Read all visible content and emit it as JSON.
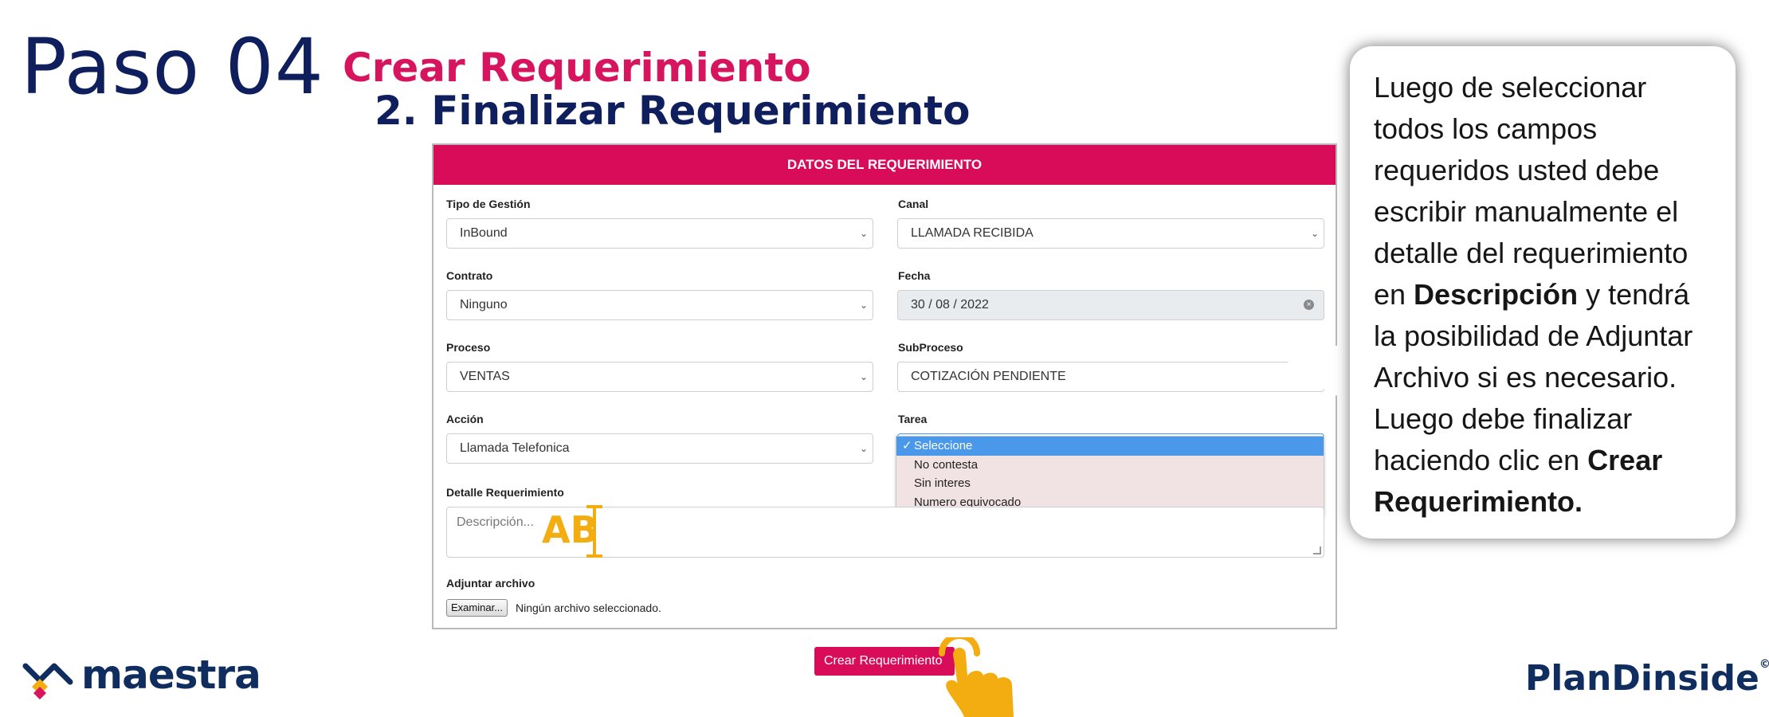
{
  "step": {
    "label": "Paso 04"
  },
  "titles": {
    "main": "Crear Requerimiento",
    "sub": "2. Finalizar Requerimiento"
  },
  "form": {
    "header": "DATOS DEL REQUERIMIENTO",
    "tipo_gestion": {
      "label": "Tipo de Gestión",
      "value": "InBound"
    },
    "canal": {
      "label": "Canal",
      "value": "LLAMADA RECIBIDA"
    },
    "contrato": {
      "label": "Contrato",
      "value": "Ninguno"
    },
    "fecha": {
      "label": "Fecha",
      "value": "30 / 08 / 2022"
    },
    "proceso": {
      "label": "Proceso",
      "value": "VENTAS"
    },
    "subproceso": {
      "label": "SubProceso",
      "value": "COTIZACIÓN PENDIENTE"
    },
    "accion": {
      "label": "Acción",
      "value": "Llamada Telefonica"
    },
    "tarea": {
      "label": "Tarea",
      "options": [
        "Seleccione",
        "No contesta",
        "Sin interes",
        "Numero equivocado"
      ],
      "selected": "Seleccione"
    },
    "detalle": {
      "label": "Detalle Requerimiento",
      "placeholder": "Descripción..."
    },
    "adjuntar": {
      "label": "Adjuntar archivo",
      "button": "Examinar...",
      "status": "Ningún archivo seleccionado."
    },
    "submit": "Crear Requerimiento"
  },
  "typing_hint": "AB",
  "callout": {
    "text_1": "Luego de seleccionar todos los campos requeridos usted debe escribir manualmente el detalle del requerimiento en ",
    "bold_1": "Descripción",
    "text_2": " y tendrá la posibilidad de Adjuntar Archivo si es necesario. Luego debe finalizar haciendo clic en ",
    "bold_2": "Crear Requerimiento."
  },
  "logos": {
    "left": "maestra",
    "right": "PlanDinside",
    "right_mark": "©"
  },
  "colors": {
    "brand_pink": "#d90c5a",
    "navy": "#0f1f5e",
    "accent_yellow": "#f3ad10",
    "option_highlight": "#4a98ea"
  },
  "icons": {
    "select_arrow": "chevron-down-icon",
    "clear": "clear-icon",
    "pointer": "hand-pointer-icon",
    "check": "check-icon"
  }
}
